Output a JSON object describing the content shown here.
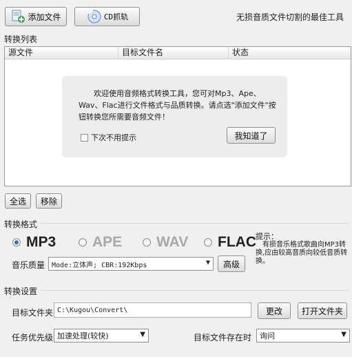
{
  "toolbar": {
    "add_file_label": "添加文件",
    "cd_rip_label": "CD抓轨",
    "slogan": "无损音质文件切割的最佳工具"
  },
  "convert_list": {
    "section_label": "转换列表",
    "columns": [
      "源文件",
      "目标文件名",
      "状态"
    ]
  },
  "welcome_popup": {
    "message": "欢迎使用音频格式转换工具，您可对Mp3、Ape、Wav、Flac进行文件格式与品质转换。请点选\"添加文件\"按钮转换您所需要音频文件！",
    "no_prompt_label": "下次不用提示",
    "no_prompt_checked": false,
    "got_it_label": "我知道了"
  },
  "list_actions": {
    "select_all_label": "全选",
    "remove_label": "移除"
  },
  "format": {
    "section_label": "转换格式",
    "options": [
      {
        "label": "MP3",
        "selected": true
      },
      {
        "label": "APE",
        "selected": false
      },
      {
        "label": "WAV",
        "selected": false
      },
      {
        "label": "FLAC",
        "selected": false
      }
    ],
    "hint_title": "提示：",
    "hint_text": "有损音乐格式歌曲向MP3转换,应由较高音质向较低音质转换。",
    "quality_label": "音乐质量",
    "quality_value": "Mode:立体声; CBR:192Kbps",
    "advanced_label": "高级"
  },
  "settings": {
    "section_label": "转换设置",
    "target_folder_label": "目标文件夹",
    "target_folder_value": "C:\\Kugou\\Convert\\",
    "change_label": "更改",
    "open_folder_label": "打开文件夹",
    "priority_label": "任务优先级",
    "priority_value": "加速处理(较快)",
    "exists_label": "目标文件存在时",
    "exists_value": "询问"
  },
  "colors": {
    "window_bg": "#f0f0f0",
    "radio_selected": "#2f6fcf",
    "disabled_text": "#a8a8a8"
  }
}
